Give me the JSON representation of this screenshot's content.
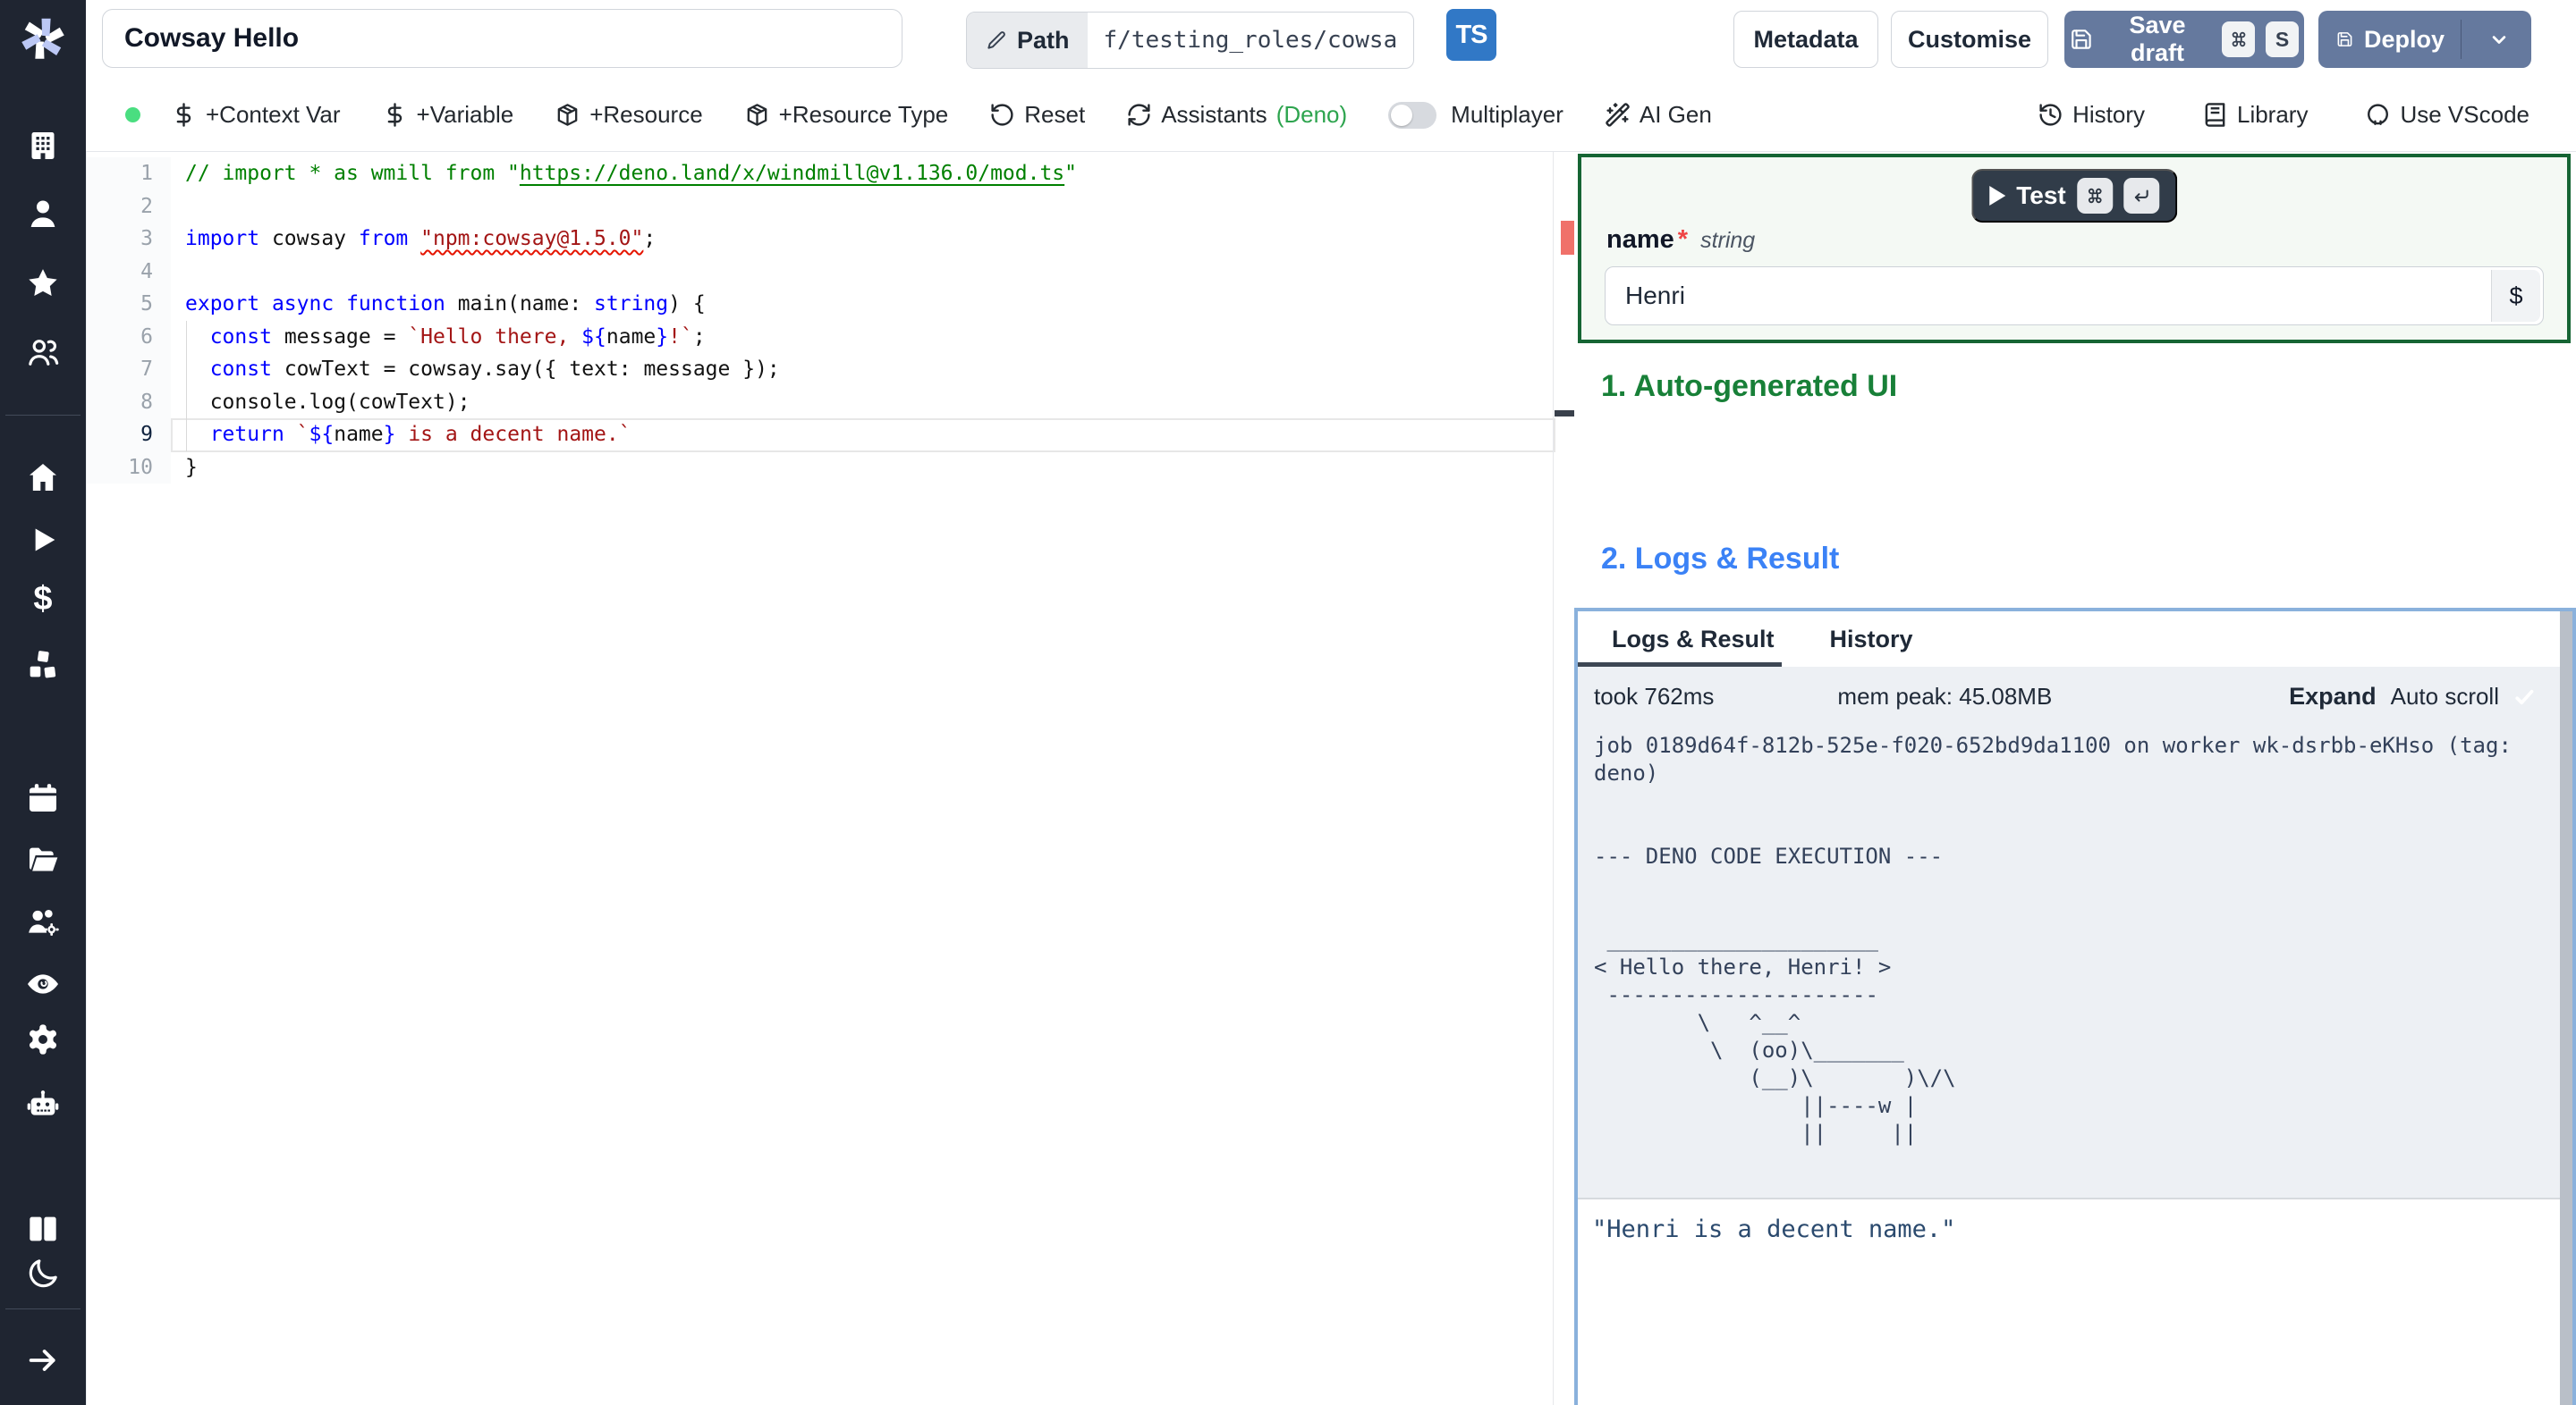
{
  "colors": {
    "accent": "#65799e",
    "tsblue": "#3178c6",
    "greenborder": "#166534",
    "hgreen": "#188038",
    "hblue": "#3b82f6",
    "deno": "#2da44e",
    "dot": "#4ade80",
    "cardblue": "#8ab1dc",
    "sidebar": "#1f2531"
  },
  "sidebar": {
    "icons": [
      {
        "name": "building-icon"
      },
      {
        "name": "user-icon"
      },
      {
        "name": "star-icon"
      },
      {
        "name": "users-icon"
      },
      {
        "name": "home-icon"
      },
      {
        "name": "play-icon"
      },
      {
        "name": "dollar-icon"
      },
      {
        "name": "boxes-icon"
      },
      {
        "name": "calendar-icon"
      },
      {
        "name": "folder-icon"
      },
      {
        "name": "users-gear-icon"
      },
      {
        "name": "eye-icon"
      },
      {
        "name": "settings-icon"
      },
      {
        "name": "bot-icon"
      },
      {
        "name": "books-icon"
      },
      {
        "name": "moon-icon"
      },
      {
        "name": "arrow-right-icon"
      }
    ]
  },
  "header": {
    "title_value": "Cowsay Hello",
    "path_label": "Path",
    "path_value": "f/testing_roles/cowsa",
    "lang_badge": "TS",
    "metadata_label": "Metadata",
    "customise_label": "Customise",
    "save_draft_label": "Save draft",
    "save_kbd_letter": "S",
    "deploy_label": "Deploy"
  },
  "toolbar": {
    "items": [
      {
        "icon": "dollar-icon",
        "label": "+Context Var"
      },
      {
        "icon": "dollar-icon",
        "label": "+Variable"
      },
      {
        "icon": "package-icon",
        "label": "+Resource"
      },
      {
        "icon": "package-icon",
        "label": "+Resource Type"
      },
      {
        "icon": "rotate-ccw-icon",
        "label": "Reset"
      },
      {
        "icon": "refresh-cw-icon",
        "label": "Assistants",
        "suffix": "(Deno)"
      }
    ],
    "multiplayer_label": "Multiplayer",
    "ai_gen": {
      "icon": "wand-icon",
      "label": "AI Gen"
    },
    "right_items": [
      {
        "icon": "history-icon",
        "label": "History"
      },
      {
        "icon": "book-icon",
        "label": "Library"
      },
      {
        "icon": "vscode-icon",
        "label": "Use VScode"
      }
    ]
  },
  "editor": {
    "active_line": 9,
    "lines": [
      {
        "tokens": [
          [
            "c",
            "// import * as wmill from \""
          ],
          [
            "clk",
            "https://deno.land/x/windmill@v1.136.0/mod.ts"
          ],
          [
            "c",
            "\""
          ]
        ]
      },
      {
        "tokens": []
      },
      {
        "tokens": [
          [
            "k",
            "import"
          ],
          [
            "d",
            " cowsay "
          ],
          [
            "k",
            "from"
          ],
          [
            "d",
            " "
          ],
          [
            "se",
            "\"npm:cowsay@1.5.0\""
          ],
          [
            "d",
            ";"
          ]
        ]
      },
      {
        "tokens": []
      },
      {
        "tokens": [
          [
            "k",
            "export"
          ],
          [
            "d",
            " "
          ],
          [
            "k",
            "async"
          ],
          [
            "d",
            " "
          ],
          [
            "k",
            "function"
          ],
          [
            "d",
            " "
          ],
          [
            "fn",
            "main"
          ],
          [
            "d",
            "("
          ],
          [
            "v",
            "name"
          ],
          [
            "d",
            ": "
          ],
          [
            "k",
            "string"
          ],
          [
            "d",
            ") {"
          ]
        ]
      },
      {
        "tokens": [
          [
            "d",
            "  "
          ],
          [
            "k",
            "const"
          ],
          [
            "d",
            " "
          ],
          [
            "v",
            "message"
          ],
          [
            "d",
            " = "
          ],
          [
            "s",
            "`Hello there, "
          ],
          [
            "kb",
            "${"
          ],
          [
            "v",
            "name"
          ],
          [
            "kb",
            "}"
          ],
          [
            "s",
            "!`"
          ],
          [
            "d",
            ";"
          ]
        ]
      },
      {
        "tokens": [
          [
            "d",
            "  "
          ],
          [
            "k",
            "const"
          ],
          [
            "d",
            " "
          ],
          [
            "v",
            "cowText"
          ],
          [
            "d",
            " = "
          ],
          [
            "v",
            "cowsay"
          ],
          [
            "d",
            "."
          ],
          [
            "fn",
            "say"
          ],
          [
            "d",
            "({ "
          ],
          [
            "v",
            "text"
          ],
          [
            "d",
            ": "
          ],
          [
            "v",
            "message"
          ],
          [
            "d",
            " });"
          ]
        ]
      },
      {
        "tokens": [
          [
            "d",
            "  "
          ],
          [
            "v",
            "console"
          ],
          [
            "d",
            "."
          ],
          [
            "fn",
            "log"
          ],
          [
            "d",
            "("
          ],
          [
            "v",
            "cowText"
          ],
          [
            "d",
            ");"
          ]
        ]
      },
      {
        "tokens": [
          [
            "d",
            "  "
          ],
          [
            "k",
            "return"
          ],
          [
            "d",
            " "
          ],
          [
            "s",
            "`"
          ],
          [
            "kb",
            "${"
          ],
          [
            "v",
            "name"
          ],
          [
            "kb",
            "}"
          ],
          [
            "s",
            " is a decent name.`"
          ]
        ]
      },
      {
        "tokens": [
          [
            "d",
            "}"
          ]
        ]
      }
    ]
  },
  "preview": {
    "test_label": "Test",
    "arg_name": "name",
    "required_mark": "*",
    "arg_type": "string",
    "arg_value": "Henri",
    "var_picker_label": "$",
    "section1": "1. Auto-generated UI",
    "section2": "2. Logs & Result",
    "tab_logs": "Logs & Result",
    "tab_history": "History",
    "took": "took 762ms",
    "mem": "mem peak: 45.08MB",
    "expand_label": "Expand",
    "autoscroll_label": "Auto scroll",
    "output_log": "job 0189d64f-812b-525e-f020-652bd9da1100 on worker wk-dsrbb-eKHso (tag: deno)\n\n\n--- DENO CODE EXECUTION ---\n\n\n _____________________\n< Hello there, Henri! >\n ---------------------\n        \\   ^__^\n         \\  (oo)\\_______\n            (__)\\       )\\/\\\n                ||----w |\n                ||     ||",
    "result_json": "\"Henri is a decent name.\""
  }
}
